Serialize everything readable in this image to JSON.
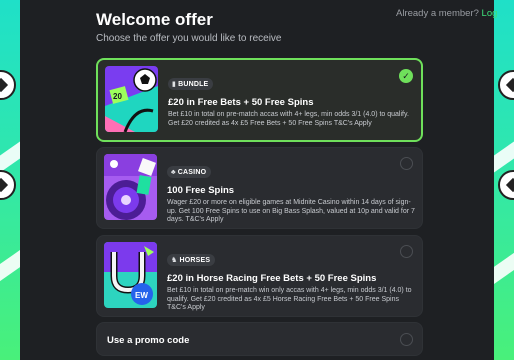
{
  "header": {
    "title": "Welcome offer",
    "subtitle": "Choose the offer you would like to receive",
    "already_member_text": "Already a member?",
    "login_link": "Log"
  },
  "offers": [
    {
      "tag": "BUNDLE",
      "tag_icon": "ticket-icon",
      "thumb_text": "20",
      "heading": "£20 in Free Bets + 50 Free Spins",
      "description": "Bet £10 in total on pre-match accas with 4+ legs, min odds 3/1 (4.0) to qualify. Get £20 credited as 4x £5 Free Bets + 50 Free Spins T&C's Apply",
      "selected": true
    },
    {
      "tag": "CASINO",
      "tag_icon": "casino-icon",
      "heading": "100 Free Spins",
      "description": "Wager £20 or more on eligible games at Midnite Casino within 14 days of sign-up. Get 100 Free Spins to use on Big Bass Splash, valued at 10p and valid for 7 days. T&C's Apply",
      "selected": false
    },
    {
      "tag": "HORSES",
      "tag_icon": "horse-icon",
      "thumb_text": "EW",
      "heading": "£20 in Horse Racing Free Bets + 50 Free Spins",
      "description": "Bet £10 in total on pre-match win only accas with 4+ legs, min odds 3/1 (4.0) to qualify. Get £20 credited as 4x £5 Horse Racing Free Bets + 50 Free Spins T&C's Apply",
      "selected": false
    }
  ],
  "promo": {
    "label": "Use a promo code"
  },
  "colors": {
    "accent": "#6fe05b",
    "background": "#1e2023",
    "card": "#2a2c30"
  }
}
